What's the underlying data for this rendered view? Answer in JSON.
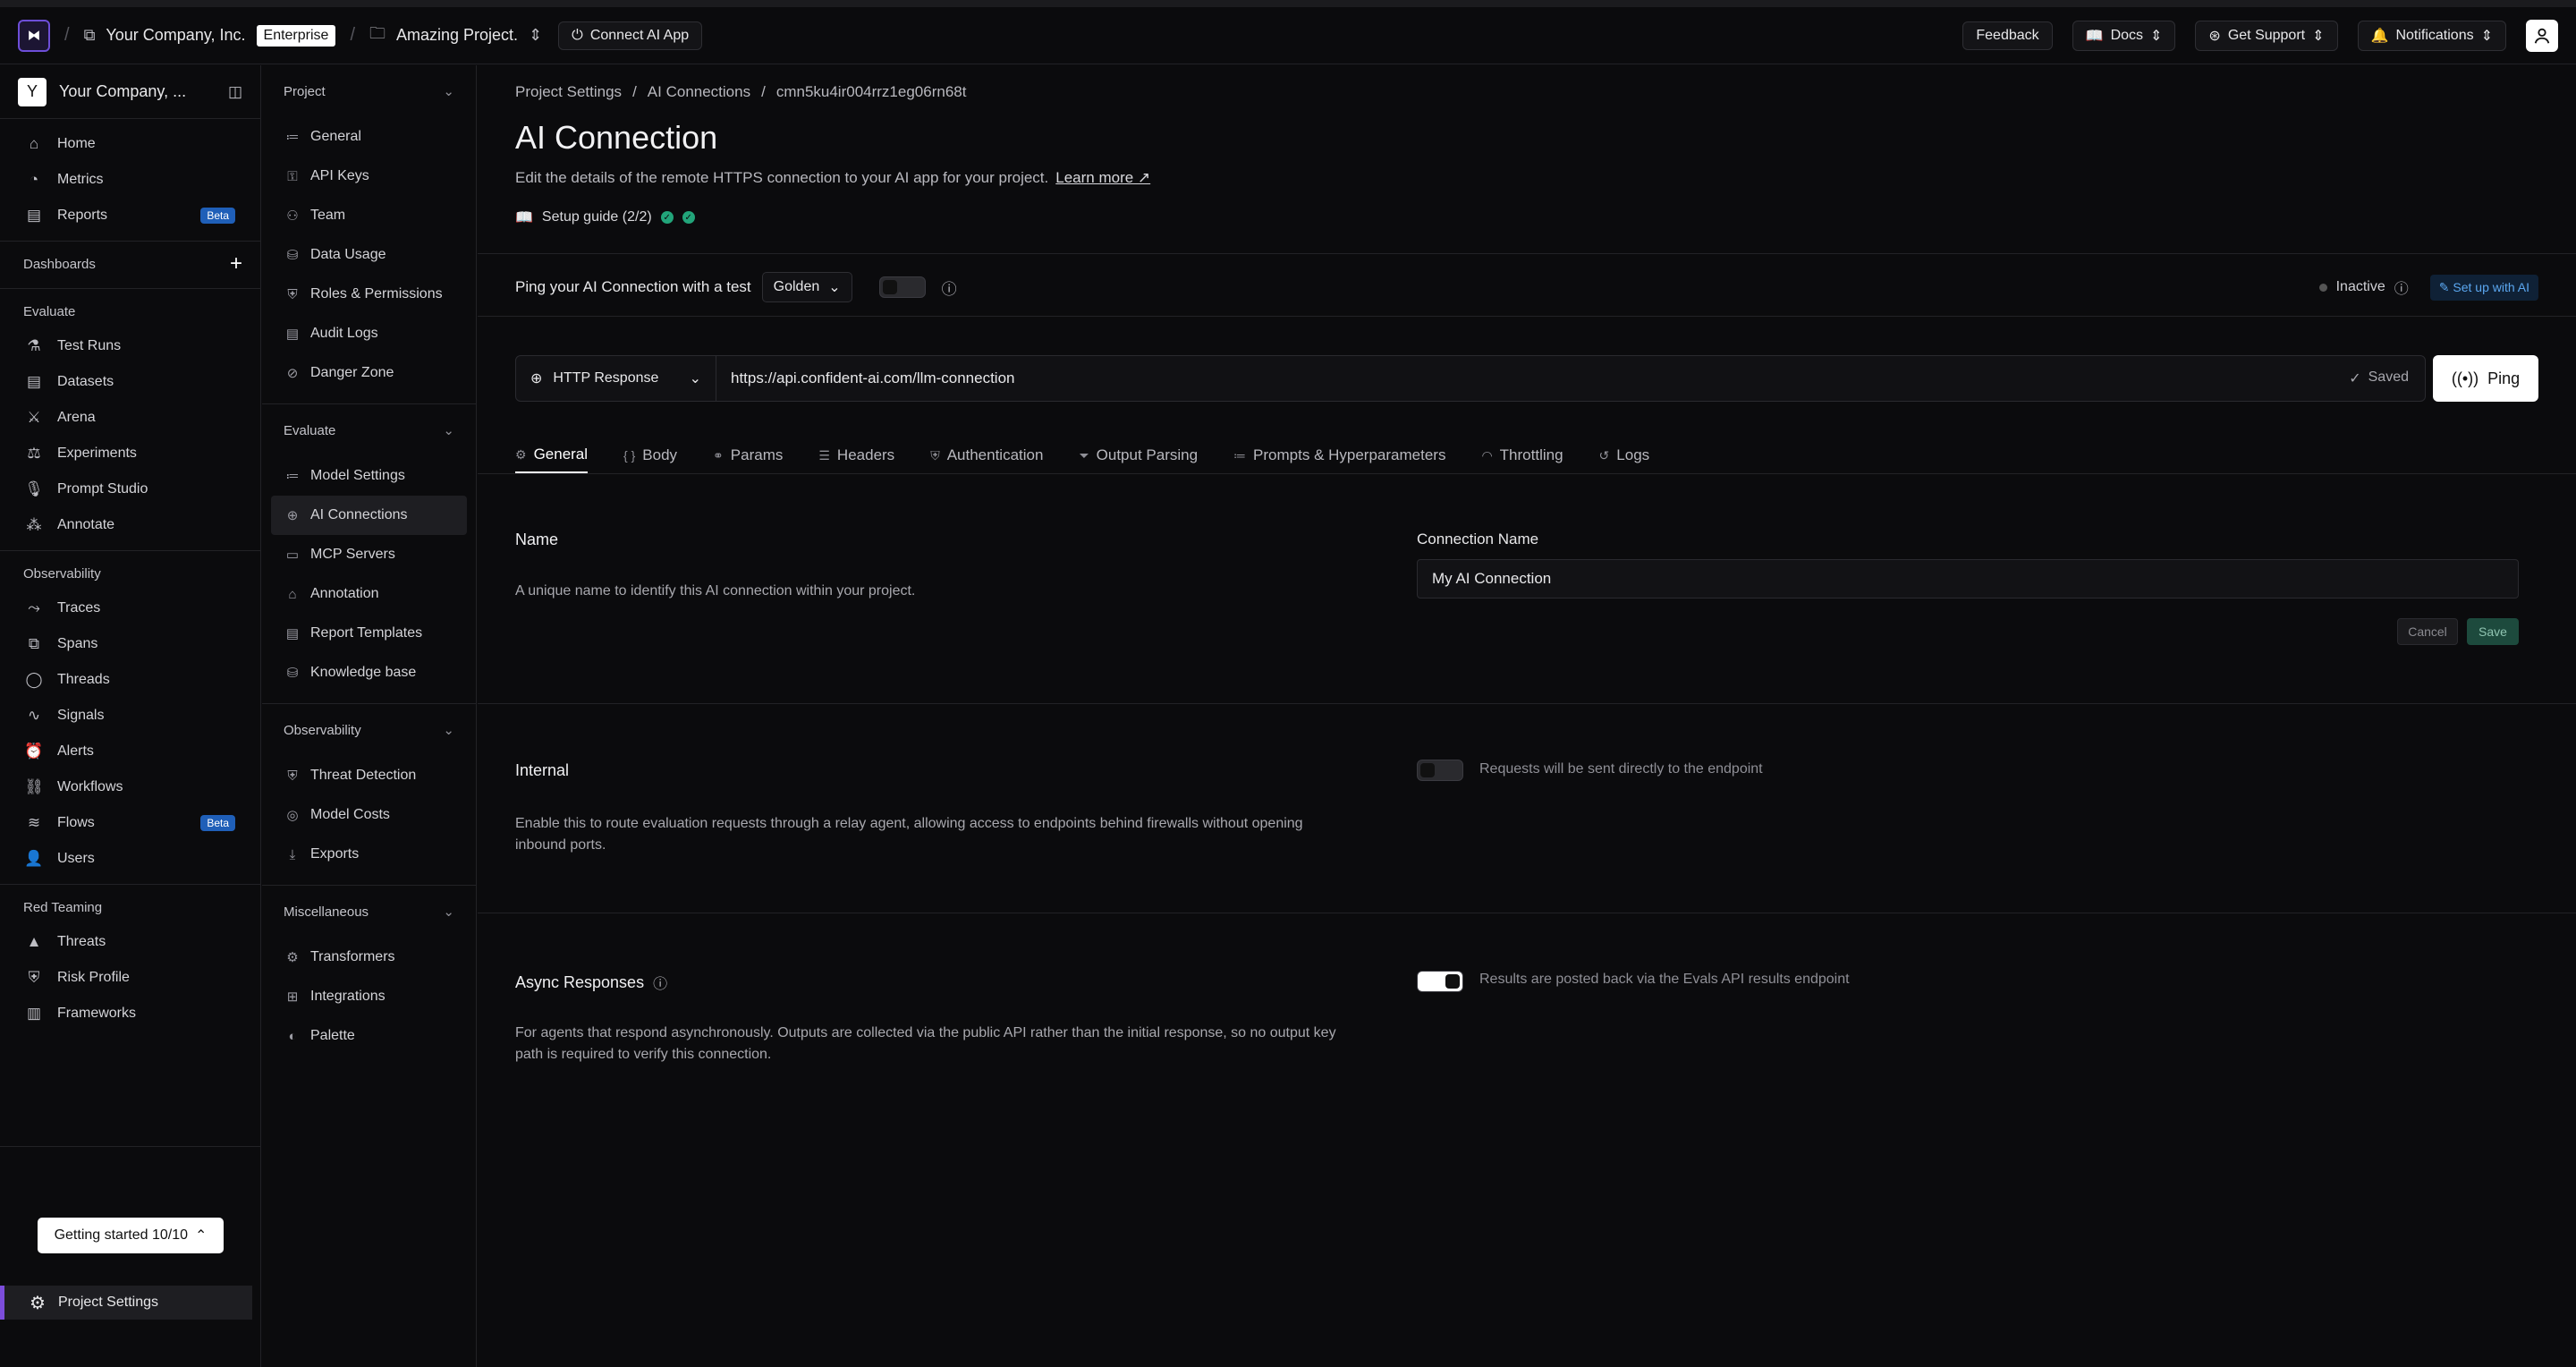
{
  "topbar": {
    "logo": "⧓",
    "org": "Your Company, Inc.",
    "plan": "Enterprise",
    "project": "Amazing Project.",
    "connect": "Connect AI App",
    "feedback": "Feedback",
    "docs": "Docs",
    "support": "Get Support",
    "notifications": "Notifications"
  },
  "sidebar": {
    "workspace_initial": "Y",
    "workspace_name": "Your Company, ...",
    "main": [
      {
        "label": "Home",
        "icon": "⌂"
      },
      {
        "label": "Metrics",
        "icon": "◔"
      },
      {
        "label": "Reports",
        "icon": "▤",
        "badge": "Beta"
      }
    ],
    "dashboards": "Dashboards",
    "evaluate_label": "Evaluate",
    "evaluate": [
      {
        "label": "Test Runs",
        "icon": "⚗"
      },
      {
        "label": "Datasets",
        "icon": "▤"
      },
      {
        "label": "Arena",
        "icon": "⚔"
      },
      {
        "label": "Experiments",
        "icon": "⚖"
      },
      {
        "label": "Prompt Studio",
        "icon": "🎙"
      },
      {
        "label": "Annotate",
        "icon": "⁂"
      }
    ],
    "observability_label": "Observability",
    "observability": [
      {
        "label": "Traces",
        "icon": "⤳"
      },
      {
        "label": "Spans",
        "icon": "⧉"
      },
      {
        "label": "Threads",
        "icon": "◯"
      },
      {
        "label": "Signals",
        "icon": "∿"
      },
      {
        "label": "Alerts",
        "icon": "⏰"
      },
      {
        "label": "Workflows",
        "icon": "⛓"
      },
      {
        "label": "Flows",
        "icon": "≋",
        "badge": "Beta"
      },
      {
        "label": "Users",
        "icon": "👤"
      }
    ],
    "red_label": "Red Teaming",
    "red": [
      {
        "label": "Threats",
        "icon": "▲"
      },
      {
        "label": "Risk Profile",
        "icon": "⛨"
      },
      {
        "label": "Frameworks",
        "icon": "▥"
      }
    ],
    "getting_started": "Getting started 10/10",
    "project_settings": "Project Settings"
  },
  "subnav": {
    "project_label": "Project",
    "project": [
      {
        "label": "General",
        "icon": "≔"
      },
      {
        "label": "API Keys",
        "icon": "⚿"
      },
      {
        "label": "Team",
        "icon": "⚇"
      },
      {
        "label": "Data Usage",
        "icon": "⛁"
      },
      {
        "label": "Roles & Permissions",
        "icon": "⛨"
      },
      {
        "label": "Audit Logs",
        "icon": "▤"
      },
      {
        "label": "Danger Zone",
        "icon": "⊘"
      }
    ],
    "evaluate_label": "Evaluate",
    "evaluate": [
      {
        "label": "Model Settings",
        "icon": "≔"
      },
      {
        "label": "AI Connections",
        "icon": "⊕"
      },
      {
        "label": "MCP Servers",
        "icon": "▭"
      },
      {
        "label": "Annotation",
        "icon": "⌂"
      },
      {
        "label": "Report Templates",
        "icon": "▤"
      },
      {
        "label": "Knowledge base",
        "icon": "⛁"
      }
    ],
    "observability_label": "Observability",
    "observability": [
      {
        "label": "Threat Detection",
        "icon": "⛨"
      },
      {
        "label": "Model Costs",
        "icon": "◎"
      },
      {
        "label": "Exports",
        "icon": "⤓"
      }
    ],
    "misc_label": "Miscellaneous",
    "misc": [
      {
        "label": "Transformers",
        "icon": "⚙"
      },
      {
        "label": "Integrations",
        "icon": "⊞"
      },
      {
        "label": "Palette",
        "icon": "◐"
      }
    ]
  },
  "main": {
    "breadcrumb": [
      "Project Settings",
      "/",
      "AI Connections",
      "/",
      "cmn5ku4ir004rrz1eg06rn68t"
    ],
    "title": "AI Connection",
    "description": "Edit the details of the remote HTTPS connection to your AI app for your project.",
    "learn_more": "Learn more ↗",
    "setup_guide": "Setup guide (2/2)",
    "ping_label": "Ping your AI Connection with a test",
    "ping_select": "Golden",
    "status": "Inactive",
    "setup_ai": "Set up with AI",
    "method": "HTTP Response",
    "url": "https://api.confident-ai.com/llm-connection",
    "saved": "Saved",
    "ping_button": "Ping",
    "tabs": [
      {
        "label": "General",
        "icon": "⚙"
      },
      {
        "label": "Body",
        "icon": "{ }"
      },
      {
        "label": "Params",
        "icon": "⚭"
      },
      {
        "label": "Headers",
        "icon": "☰"
      },
      {
        "label": "Authentication",
        "icon": "⛨"
      },
      {
        "label": "Output Parsing",
        "icon": "⏷"
      },
      {
        "label": "Prompts & Hyperparameters",
        "icon": "≔"
      },
      {
        "label": "Throttling",
        "icon": "◠"
      },
      {
        "label": "Logs",
        "icon": "↺"
      }
    ],
    "name_section": {
      "title": "Name",
      "desc": "A unique name to identify this AI connection within your project.",
      "field_label": "Connection Name",
      "value": "My AI Connection",
      "cancel": "Cancel",
      "save": "Save"
    },
    "internal_section": {
      "title": "Internal",
      "desc": "Enable this to route evaluation requests through a relay agent, allowing access to endpoints behind firewalls without opening inbound ports.",
      "hint": "Requests will be sent directly to the endpoint"
    },
    "async_section": {
      "title": "Async Responses",
      "desc": "For agents that respond asynchronously. Outputs are collected via the public API rather than the initial response, so no output key path is required to verify this connection.",
      "hint": "Results are posted back via the Evals API results endpoint"
    }
  }
}
